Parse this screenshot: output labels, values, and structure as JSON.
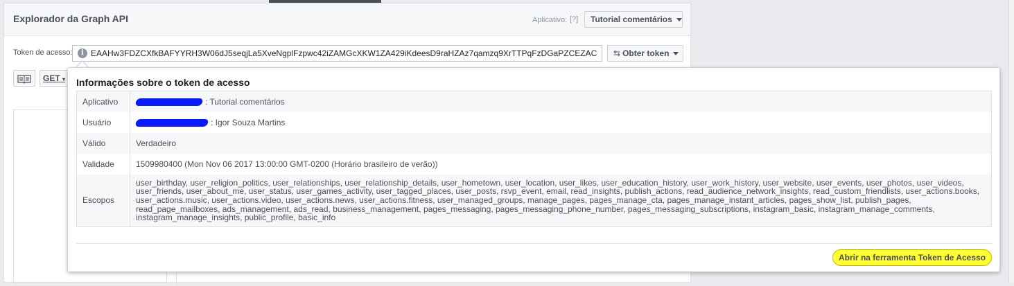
{
  "explorer": {
    "title": "Explorador da Graph API",
    "app_label": "Aplicativo:",
    "help_link": "[?]",
    "app_select": "Tutorial comentários",
    "token_label": "Token de acesso:",
    "token_value": "EAAHw3FDZCXfkBAFYYRH3W06dJ5seqjLa5XveNgplFzpwc42iZAMGcXKW1ZA429iKdeesD9raHZAz7qamzq9XrTTPqFzDGaPZCEZAC",
    "get_token_label": "Obter token",
    "method": "GET"
  },
  "token_info": {
    "title": "Informações sobre o token de acesso",
    "rows": [
      {
        "key": "Aplicativo",
        "value": ": Tutorial comentários"
      },
      {
        "key": "Usuário",
        "value": ": Igor Souza Martins"
      },
      {
        "key": "Válido",
        "value": "Verdadeiro"
      },
      {
        "key": "Validade",
        "value": "1509980400 (Mon Nov 06 2017 13:00:00 GMT-0200 (Horário brasileiro de verão))"
      },
      {
        "key": "Escopos",
        "value": "user_birthday, user_religion_politics, user_relationships, user_relationship_details, user_hometown, user_location, user_likes, user_education_history, user_work_history, user_website, user_events, user_photos, user_videos, user_friends, user_about_me, user_status, user_games_activity, user_tagged_places, user_posts, rsvp_event, email, read_insights, publish_actions, read_audience_network_insights, read_custom_friendlists, user_actions.books, user_actions.music, user_actions.video, user_actions.news, user_actions.fitness, user_managed_groups, manage_pages, pages_manage_cta, pages_manage_instant_articles, pages_show_list, publish_pages, read_page_mailboxes, ads_management, ads_read, business_management, pages_messaging, pages_messaging_phone_number, pages_messaging_subscriptions, instagram_basic, instagram_manage_comments, instagram_manage_insights, public_profile, basic_info"
      }
    ],
    "open_tool_button": "Abrir na ferramenta Token de Acesso"
  },
  "colors": {
    "highlight": "#ffff33",
    "redaction": "#0b1aff"
  }
}
